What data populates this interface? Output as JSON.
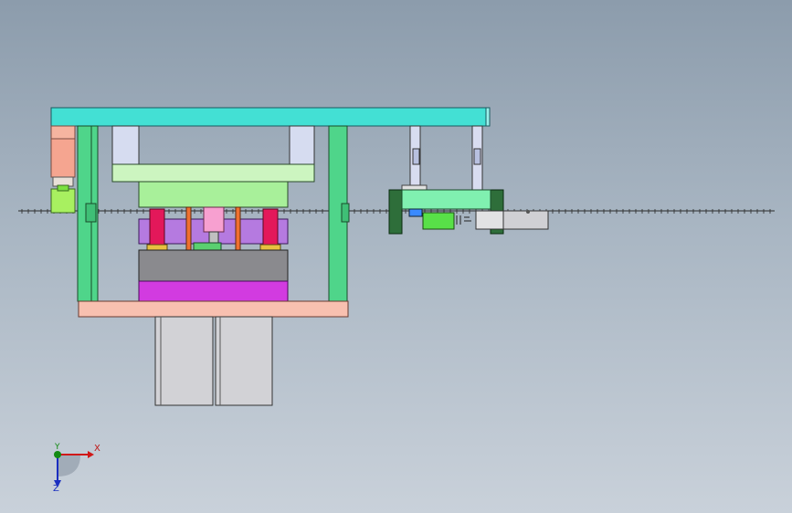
{
  "viewport": {
    "background_top": "#8c9cac",
    "background_bottom": "#c9d1da"
  },
  "colors": {
    "top_plate": "#43e0d4",
    "guide_post": "#4fd58a",
    "lower_base": "#f8c0b0",
    "support_block": "#d2d2d6",
    "upper_plate": "#ccf5c0",
    "punch_holder": "#a8f09a",
    "stripper": "#b57ae0",
    "die_block": "#8a8a8e",
    "die_shoe": "#d23be0",
    "spring": "#e3185a",
    "pilot_pin": "#f07030",
    "punch": "#f7a0d0",
    "feeder_frame": "#2e6e3a",
    "feeder_plate": "#80f0b0",
    "feeder_box": "#58e048"
  },
  "triad": {
    "x_label": "X",
    "y_label": "Y",
    "z_label": "Z",
    "x_color": "#d01818",
    "y_color": "#138a13",
    "z_color": "#1a2ec0"
  }
}
